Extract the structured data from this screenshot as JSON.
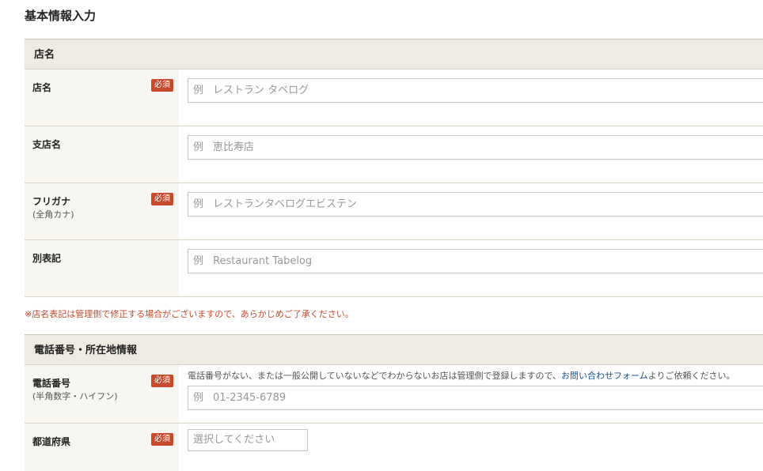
{
  "page": {
    "title": "基本情報入力"
  },
  "store_section": {
    "header": "店名",
    "rows": [
      {
        "label": "店名",
        "sub": "",
        "required": "必須",
        "placeholder_prefix": "例",
        "placeholder": "レストラン タベログ"
      },
      {
        "label": "支店名",
        "sub": "",
        "required": "",
        "placeholder_prefix": "例",
        "placeholder": "恵比寿店"
      },
      {
        "label": "フリガナ",
        "sub": "(全角カナ)",
        "required": "必須",
        "placeholder_prefix": "例",
        "placeholder": "レストランタベログエビステン"
      },
      {
        "label": "別表記",
        "sub": "",
        "required": "",
        "placeholder_prefix": "例",
        "placeholder": "Restaurant Tabelog"
      }
    ],
    "note": "※店名表記は管理側で修正する場合がございますので、あらかじめご了承ください。"
  },
  "contact_section": {
    "header": "電話番号・所在地情報",
    "phone": {
      "label": "電話番号",
      "sub": "(半角数字・ハイフン)",
      "required": "必須",
      "note_before": "電話番号がない、または一般公開していないなどでわからないお店は管理側で登録しますので、",
      "note_link": "お問い合わせフォーム",
      "note_after": "よりご依頼ください。",
      "placeholder_prefix": "例",
      "placeholder": "01-2345-6789"
    },
    "prefecture": {
      "label": "都道府県",
      "required": "必須",
      "select_value": "選択してください"
    }
  },
  "colors": {
    "required_badge": "#c84a2d",
    "header_bg": "#efebe3",
    "label_bg": "#f8f6f1",
    "link": "#1a4f8b"
  }
}
